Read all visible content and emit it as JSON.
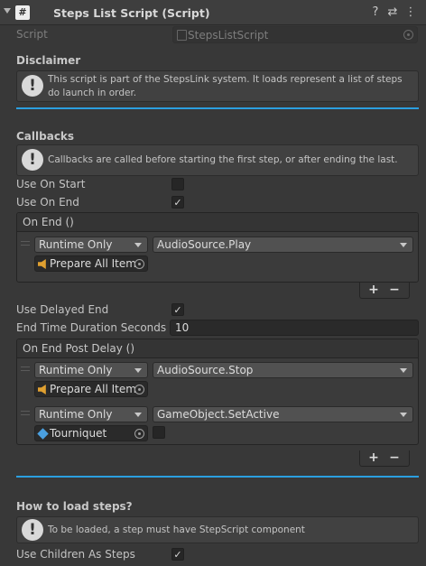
{
  "header": {
    "title": "Steps List Script (Script)",
    "script_icon_glyph": "#",
    "help_glyph": "?",
    "settings_glyph": "⇄",
    "menu_glyph": "⋮"
  },
  "script_field": {
    "label": "Script",
    "value": "StepsListScript"
  },
  "disclaimer": {
    "title": "Disclaimer",
    "text": "This script is part of the StepsLink system. It loads represent a list of steps do launch in order."
  },
  "callbacks": {
    "title": "Callbacks",
    "text": "Callbacks are called before starting the first step, or after ending the last.",
    "use_on_start": {
      "label": "Use On Start",
      "checked": false
    },
    "use_on_end": {
      "label": "Use On End",
      "checked": true
    }
  },
  "on_end_event": {
    "title": "On End ()",
    "entries": [
      {
        "mode": "Runtime Only",
        "function": "AudioSource.Play",
        "object": "Prepare All Item"
      }
    ],
    "add_label": "+",
    "remove_label": "−"
  },
  "delayed": {
    "use_delayed_end": {
      "label": "Use Delayed End",
      "checked": true
    },
    "duration": {
      "label": "End Time Duration Seconds",
      "value": "10"
    }
  },
  "on_end_post_delay_event": {
    "title": "On End Post Delay ()",
    "entries": [
      {
        "mode": "Runtime Only",
        "function": "AudioSource.Stop",
        "object": "Prepare All Item"
      },
      {
        "mode": "Runtime Only",
        "function": "GameObject.SetActive",
        "object": "Tourniquet",
        "bool_checked": false
      }
    ],
    "add_label": "+",
    "remove_label": "−"
  },
  "load_steps": {
    "title": "How to load steps?",
    "text": "To be loaded, a step must have StepScript component",
    "use_children": {
      "label": "Use Children As Steps",
      "checked": true
    }
  },
  "colors": {
    "accent_separator": "#2b9fe0",
    "background": "#383838",
    "speaker_icon": "#e0a030",
    "cube_icon": "#4aa0e0"
  },
  "check_glyph": "✓",
  "warn_glyph": "!"
}
